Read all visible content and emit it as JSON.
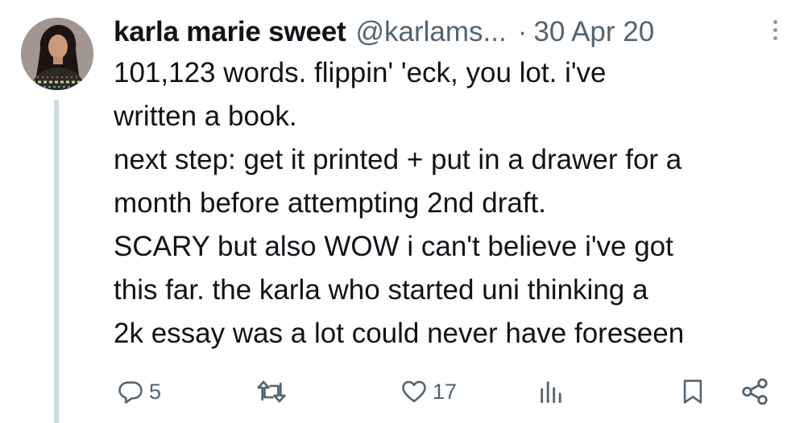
{
  "tweet": {
    "author_name": "karla marie sweet",
    "handle": "@karlams...",
    "separator": "·",
    "date": "30 Apr 20",
    "text_lines": [
      "101,123 words. flippin' 'eck, you lot. i've",
      "written a book.",
      "next step: get it printed + put in a drawer for a",
      "month before attempting 2nd draft.",
      "SCARY but also WOW i can't believe i've got",
      "this far. the karla who started uni thinking a",
      "2k essay was a lot could never have foreseen"
    ]
  },
  "actions": {
    "reply_count": "5",
    "retweet_count": "",
    "like_count": "17",
    "views_count": ""
  },
  "icons": {
    "more": "more-vertical-icon",
    "reply": "reply-bubble-icon",
    "retweet": "retweet-icon",
    "like": "heart-icon",
    "views": "bar-chart-icon",
    "bookmark": "bookmark-icon",
    "share": "share-icon"
  },
  "colors": {
    "text_primary": "#0f1419",
    "text_secondary": "#536471",
    "thread_line": "#cfd9de"
  }
}
